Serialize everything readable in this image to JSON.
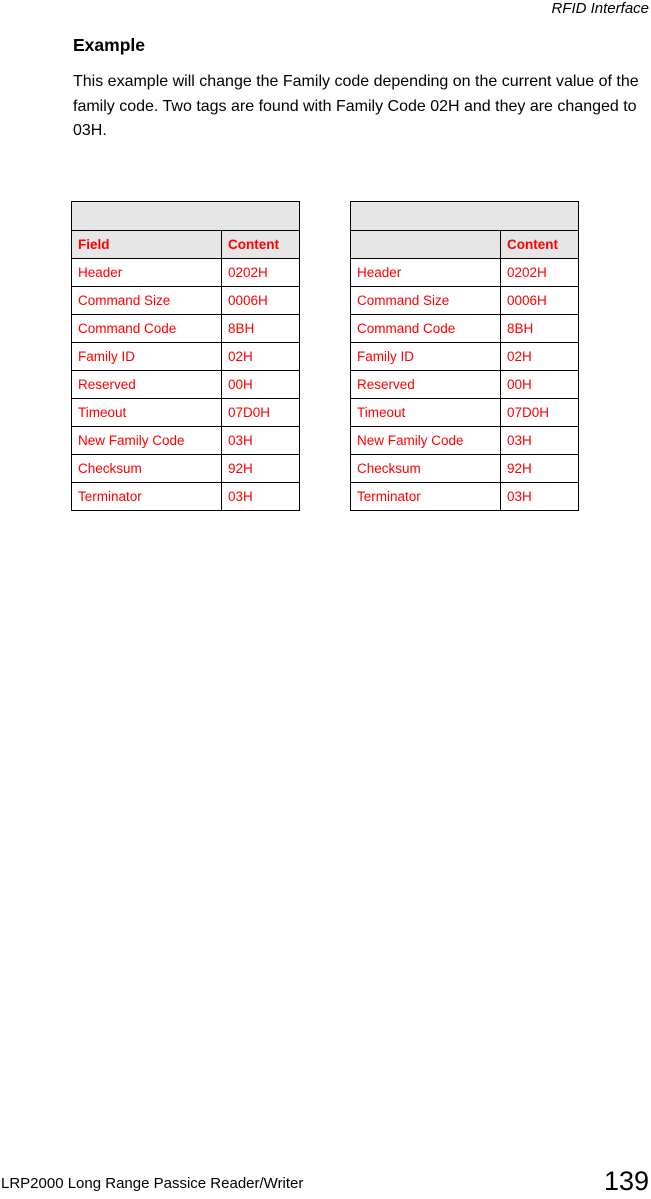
{
  "header": {
    "running_title": "RFID Interface"
  },
  "section": {
    "title": "Example",
    "paragraph": "This example will change the Family code depending on the current value of the family code. Two tags are found with Family Code 02H and they are changed to 03H."
  },
  "tables": [
    {
      "title": "",
      "columns": [
        "Field",
        "Content"
      ],
      "rows": [
        [
          "Header",
          "0202H"
        ],
        [
          "Command Size",
          "0006H"
        ],
        [
          "Command Code",
          "8BH"
        ],
        [
          "Family ID",
          "02H"
        ],
        [
          "Reserved",
          "00H"
        ],
        [
          "Timeout",
          "07D0H"
        ],
        [
          "New Family Code",
          "03H"
        ],
        [
          "Checksum",
          "92H"
        ],
        [
          "Terminator",
          "03H"
        ]
      ]
    },
    {
      "title": "",
      "columns": [
        "",
        "Content"
      ],
      "rows": [
        [
          "Header",
          "0202H"
        ],
        [
          "Command Size",
          "0006H"
        ],
        [
          "Command Code",
          "8BH"
        ],
        [
          "Family ID",
          "02H"
        ],
        [
          "Reserved",
          "00H"
        ],
        [
          "Timeout",
          "07D0H"
        ],
        [
          "New Family Code",
          "03H"
        ],
        [
          "Checksum",
          "92H"
        ],
        [
          "Terminator",
          "03H"
        ]
      ]
    }
  ],
  "footer": {
    "document_title": "LRP2000 Long Range Passice Reader/Writer",
    "page_number": "139"
  },
  "colors": {
    "table_text": "#ff0000",
    "table_header_bg": "#e6e6e6",
    "border": "#000000"
  }
}
